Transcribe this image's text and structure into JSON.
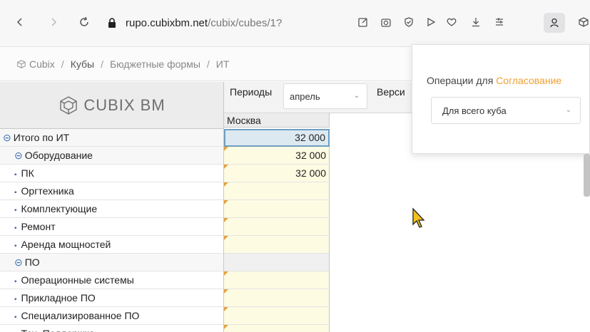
{
  "browser": {
    "url_domain": "rupo.cubixbm.net",
    "url_path": "/cubix/cubes/1?"
  },
  "breadcrumb": {
    "items": [
      "Cubix",
      "Кубы",
      "Бюджетные формы",
      "ИТ"
    ]
  },
  "logo": {
    "text": "CUBIX BM"
  },
  "filters": {
    "periods_label": "Периоды",
    "period_value": "апрель",
    "version_label": "Верси"
  },
  "column": {
    "header": "Москва"
  },
  "rows": [
    {
      "label": "Итого по ИТ",
      "level": 0,
      "value": "32 000"
    },
    {
      "label": "Оборудование",
      "level": 1,
      "value": "32 000"
    },
    {
      "label": "ПК",
      "level": 2,
      "value": "32 000"
    },
    {
      "label": "Оргтехника",
      "level": 2,
      "value": ""
    },
    {
      "label": "Комплектующие",
      "level": 2,
      "value": ""
    },
    {
      "label": "Ремонт",
      "level": 2,
      "value": ""
    },
    {
      "label": "Аренда мощностей",
      "level": 2,
      "value": ""
    },
    {
      "label": "ПО",
      "level": 1,
      "value": ""
    },
    {
      "label": "Операционные системы",
      "level": 2,
      "value": ""
    },
    {
      "label": "Прикладное ПО",
      "level": 2,
      "value": ""
    },
    {
      "label": "Специализированное ПО",
      "level": 2,
      "value": ""
    },
    {
      "label": "Тех. Поддержка",
      "level": 2,
      "value": ""
    }
  ],
  "popup": {
    "title_prefix": "Операции для ",
    "title_accent": "Согласование",
    "select_value": "Для всего куба"
  },
  "colors": {
    "accent": "#f0a030",
    "editable_cell": "#fdfbe2",
    "selected_border": "#6e9ec2"
  },
  "icons": [
    "back-icon",
    "forward-icon",
    "reload-icon",
    "lock-icon",
    "edit-page-icon",
    "camera-icon",
    "shield-icon",
    "play-icon",
    "heart-icon",
    "download-icon",
    "collections-icon",
    "profile-icon",
    "extensions-icon",
    "cube-icon",
    "collapse-icon",
    "bullet-icon",
    "mouse-cursor-icon"
  ]
}
